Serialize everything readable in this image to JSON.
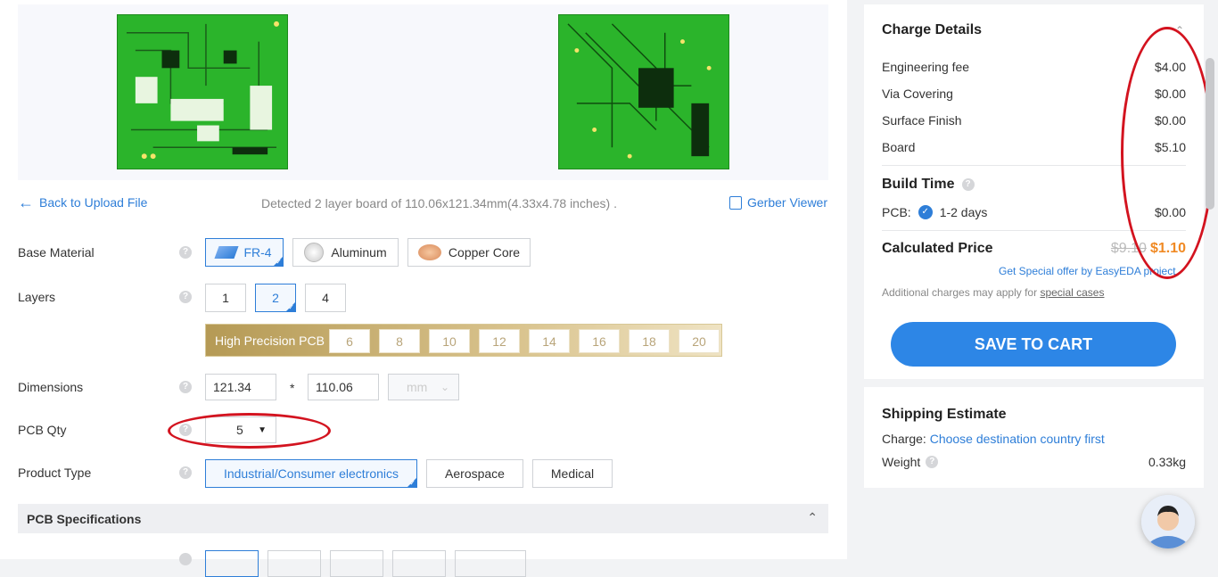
{
  "nav": {
    "back": "Back to Upload File",
    "detected": "Detected 2 layer board of 110.06x121.34mm(4.33x4.78 inches) .",
    "gerber": "Gerber Viewer"
  },
  "form": {
    "base_material": {
      "label": "Base Material",
      "options": [
        "FR-4",
        "Aluminum",
        "Copper Core"
      ],
      "selected": "FR-4"
    },
    "layers": {
      "label": "Layers",
      "options": [
        "1",
        "2",
        "4"
      ],
      "selected": "2"
    },
    "high_precision": {
      "label": "High Precision PCB",
      "options": [
        "6",
        "8",
        "10",
        "12",
        "14",
        "16",
        "18",
        "20"
      ]
    },
    "dimensions": {
      "label": "Dimensions",
      "width": "121.34",
      "times": "*",
      "height": "110.06",
      "unit": "mm"
    },
    "qty": {
      "label": "PCB Qty",
      "value": "5"
    },
    "product_type": {
      "label": "Product Type",
      "options": [
        "Industrial/Consumer electronics",
        "Aerospace",
        "Medical"
      ],
      "selected": "Industrial/Consumer electronics"
    },
    "spec_header": "PCB Specifications"
  },
  "charges": {
    "title": "Charge Details",
    "items": [
      {
        "name": "Engineering fee",
        "value": "$4.00"
      },
      {
        "name": "Via Covering",
        "value": "$0.00"
      },
      {
        "name": "Surface Finish",
        "value": "$0.00"
      },
      {
        "name": "Board",
        "value": "$5.10"
      }
    ],
    "build_time": {
      "title": "Build Time",
      "pcb_label": "PCB:",
      "option": "1-2 days",
      "value": "$0.00"
    },
    "calculated": {
      "label": "Calculated Price",
      "old": "$9.10",
      "new": "$1.10"
    },
    "special_offer": "Get Special offer by EasyEDA project",
    "note_prefix": "Additional charges may apply for ",
    "note_link": "special cases",
    "cta": "SAVE TO CART"
  },
  "shipping": {
    "title": "Shipping Estimate",
    "charge_label": "Charge:",
    "charge_link": "Choose destination country first",
    "weight_label": "Weight",
    "weight_value": "0.33kg"
  },
  "colors": {
    "accent": "#2e7ed8",
    "price_orange": "#f08a24",
    "annotation_red": "#d3131f",
    "pcb_green": "#2bb42b"
  },
  "icons": {
    "help": "question-circle-icon",
    "back": "arrow-left-icon",
    "gerber": "gerber-viewer-icon",
    "chevron": "chevron-down-icon",
    "collapse": "chevron-up-icon",
    "check": "check-circle-icon"
  }
}
